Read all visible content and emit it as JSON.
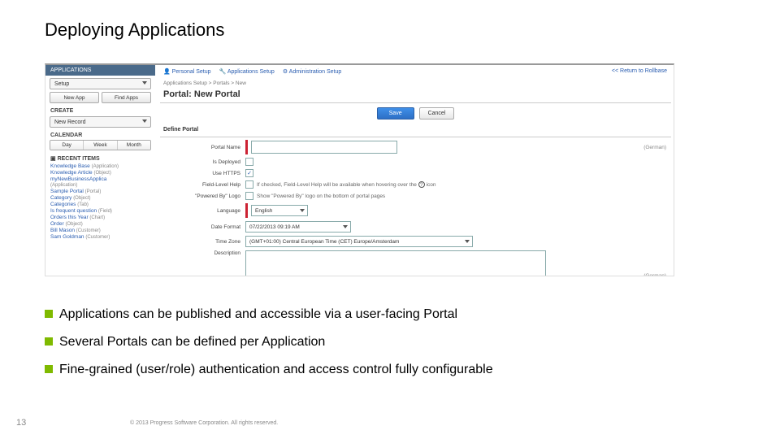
{
  "title": "Deploying Applications",
  "screenshot": {
    "sidebar": {
      "apps_header": "APPLICATIONS",
      "app_selected": "Setup",
      "new_app": "New App",
      "find_apps": "Find Apps",
      "create_header": "CREATE",
      "create_selected": "New Record",
      "calendar_header": "CALENDAR",
      "cal": {
        "day": "Day",
        "week": "Week",
        "month": "Month"
      },
      "recent_header": "RECENT ITEMS",
      "items": [
        {
          "name": "Knowledge Base",
          "type": "(Application)"
        },
        {
          "name": "Knowledge Article",
          "type": "(Object)"
        },
        {
          "name": "myNewBusinessApplica",
          "type": ""
        },
        {
          "name": "(Application)",
          "type": ""
        },
        {
          "name": "Sample Portal",
          "type": "(Portal)"
        },
        {
          "name": "Category",
          "type": "(Object)"
        },
        {
          "name": "Categories",
          "type": "(Tab)"
        },
        {
          "name": "Is frequent question",
          "type": "(Field)"
        },
        {
          "name": "Orders this Year",
          "type": "(Chart)"
        },
        {
          "name": "Order",
          "type": "(Object)"
        },
        {
          "name": "Bill Mason",
          "type": "(Customer)"
        },
        {
          "name": "Sam Goldman",
          "type": "(Customer)"
        }
      ]
    },
    "header": {
      "personal": "Personal Setup",
      "applications": "Applications Setup",
      "admin": "Administration Setup",
      "return": "<< Return to Rollbase"
    },
    "breadcrumb": "Applications Setup > Portals > New",
    "page_title": "Portal: New Portal",
    "actions": {
      "save": "Save",
      "cancel": "Cancel"
    },
    "section": "Define Portal",
    "form": {
      "portal_name": "Portal Name",
      "german": "(German)",
      "is_deployed": "Is Deployed",
      "use_https": "Use HTTPS",
      "field_help": "Field-Level Help",
      "field_help_hint": "If checked, Field-Level Help will be available when hovering over the",
      "icon_tail": "icon",
      "powered_by": "\"Powered By\" Logo",
      "powered_by_hint": "Show \"Powered By\" logo on the bottom of portal pages",
      "language": "Language",
      "language_value": "English",
      "date_format": "Date Format",
      "date_format_value": "07/22/2013 09:19 AM",
      "time_zone": "Time Zone",
      "time_zone_value": "(GMT+01:00) Central European Time (CET) Europe/Amsterdam",
      "description": "Description"
    }
  },
  "bullets": [
    "Applications can be published and accessible via a user-facing Portal",
    "Several Portals can be defined per Application",
    "Fine-grained (user/role) authentication and access control fully configurable"
  ],
  "page_number": "13",
  "copyright": "© 2013 Progress Software Corporation. All rights reserved."
}
